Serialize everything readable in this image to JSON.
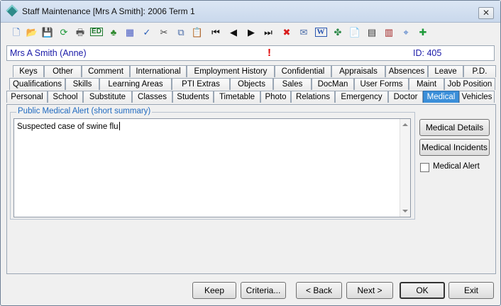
{
  "window": {
    "title": "Staff Maintenance  [Mrs A Smith]: 2006 Term 1",
    "close_label": "✕"
  },
  "toolbar": {
    "icons": [
      {
        "name": "new-icon",
        "glyph": "🗋",
        "color": "#3a6fc4"
      },
      {
        "name": "open-folder-icon",
        "glyph": "📂",
        "color": "#d4a017"
      },
      {
        "name": "save-icon",
        "glyph": "💾",
        "color": "#2a4fa8"
      },
      {
        "name": "refresh-icon",
        "glyph": "⟳",
        "color": "#1e9a3a"
      },
      {
        "name": "print-icon",
        "glyph": "🖶",
        "color": "#555"
      },
      {
        "name": "edit-icon",
        "glyph": "ED",
        "color": "#1e7a2e"
      },
      {
        "name": "tree-icon",
        "glyph": "♣",
        "color": "#2e8a2e"
      },
      {
        "name": "calculator-icon",
        "glyph": "▦",
        "color": "#4a5ec4"
      },
      {
        "name": "spellcheck-icon",
        "glyph": "✓",
        "color": "#2a5fb8"
      },
      {
        "name": "cut-icon",
        "glyph": "✂",
        "color": "#444"
      },
      {
        "name": "copy-icon",
        "glyph": "⧉",
        "color": "#4a6ca8"
      },
      {
        "name": "paste-icon",
        "glyph": "📋",
        "color": "#b58a2a"
      },
      {
        "name": "first-record-icon",
        "glyph": "⏮",
        "color": "#111"
      },
      {
        "name": "previous-record-icon",
        "glyph": "◀",
        "color": "#111"
      },
      {
        "name": "next-record-icon",
        "glyph": "▶",
        "color": "#111"
      },
      {
        "name": "last-record-icon",
        "glyph": "⏭",
        "color": "#111"
      },
      {
        "name": "delete-icon",
        "glyph": "✖",
        "color": "#d81c1c"
      },
      {
        "name": "email-icon",
        "glyph": "✉",
        "color": "#4a6ca8"
      },
      {
        "name": "word-icon",
        "glyph": "W",
        "color": "#2a56b0"
      },
      {
        "name": "grid-icon",
        "glyph": "✤",
        "color": "#2e8a4a"
      },
      {
        "name": "clipboard-icon",
        "glyph": "📄",
        "color": "#b58a2a"
      },
      {
        "name": "calendar-icon",
        "glyph": "▤",
        "color": "#333"
      },
      {
        "name": "report-icon",
        "glyph": "▥",
        "color": "#a02020"
      },
      {
        "name": "tag-icon",
        "glyph": "⌖",
        "color": "#3a6fc4"
      },
      {
        "name": "add-document-icon",
        "glyph": "✚",
        "color": "#1e9a3a"
      }
    ]
  },
  "info": {
    "name": "Mrs A Smith (Anne)",
    "alert": "!",
    "id": "ID: 405"
  },
  "tabs": {
    "row1": [
      {
        "label": "Keys"
      },
      {
        "label": "Other"
      },
      {
        "label": "Comment"
      },
      {
        "label": "International"
      },
      {
        "label": "Employment History"
      },
      {
        "label": "Confidential"
      },
      {
        "label": "Appraisals"
      },
      {
        "label": "Absences"
      },
      {
        "label": "Leave"
      },
      {
        "label": "P.D."
      }
    ],
    "row2": [
      {
        "label": "Qualifications"
      },
      {
        "label": "Skills"
      },
      {
        "label": "Learning Areas"
      },
      {
        "label": "PTI Extras"
      },
      {
        "label": "Objects"
      },
      {
        "label": "Sales"
      },
      {
        "label": "DocMan"
      },
      {
        "label": "User Forms"
      },
      {
        "label": "Maint"
      },
      {
        "label": "Job Position"
      }
    ],
    "row3": [
      {
        "label": "Personal"
      },
      {
        "label": "School"
      },
      {
        "label": "Substitute"
      },
      {
        "label": "Classes"
      },
      {
        "label": "Students"
      },
      {
        "label": "Timetable"
      },
      {
        "label": "Photo"
      },
      {
        "label": "Relations"
      },
      {
        "label": "Emergency"
      },
      {
        "label": "Doctor"
      },
      {
        "label": "Medical",
        "active": true
      },
      {
        "label": "Vehicles"
      }
    ]
  },
  "medical": {
    "group_label": "Public Medical Alert (short summary)",
    "alert_text": "Suspected case of swine flu",
    "details_button": "Medical Details",
    "incidents_button": "Medical Incidents",
    "alert_checkbox_label": "Medical Alert",
    "alert_checked": false
  },
  "footer": {
    "keep": "Keep",
    "criteria": "Criteria...",
    "back": "< Back",
    "next": "Next >",
    "ok": "OK",
    "exit": "Exit"
  }
}
